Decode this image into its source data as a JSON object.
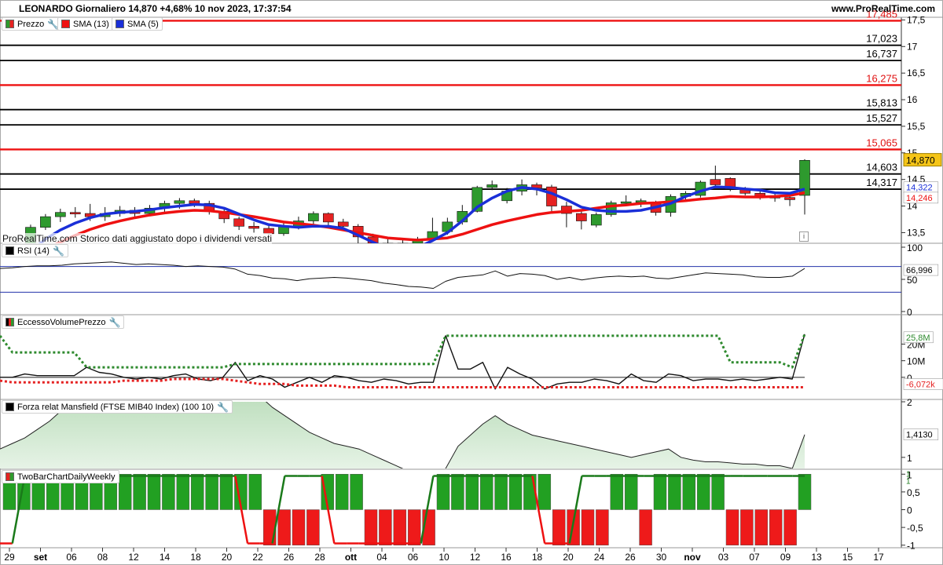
{
  "header": {
    "title": "LEONARDO Giornaliero 14,870 +4,68% 10 nov 2023, 17:37:54",
    "site": "www.ProRealTime.com"
  },
  "legends": {
    "price": "Prezzo",
    "sma13": "SMA (13)",
    "sma5": "SMA (5)",
    "rsi": "RSI (14)",
    "evp": "EccessoVolumePrezzo",
    "mansfield": "Forza relat Mansfield (FTSE MIB40 Index) (100 10)",
    "twobar": "TwoBarChartDailyWeekly"
  },
  "note": "ProRealTime.com Storico dati aggiustato dopo i dividendi versati",
  "colors": {
    "up": "#2e9a2e",
    "down": "#e52222",
    "sma13": "#ee1111",
    "sma5": "#1a2fd8",
    "lastPrice": "#f5c518"
  },
  "chart_data": [
    {
      "type": "candlestick",
      "panel": "Prezzo",
      "ylim": [
        13.3,
        17.55
      ],
      "yticks": [
        "13,5",
        "14",
        "14,5",
        "15",
        "15,5",
        "16",
        "16,5",
        "17",
        "17,5"
      ],
      "x_tick_labels": [
        "29",
        "set",
        "06",
        "08",
        "12",
        "14",
        "18",
        "20",
        "22",
        "26",
        "28",
        "ott",
        "04",
        "06",
        "10",
        "12",
        "16",
        "18",
        "20",
        "24",
        "26",
        "30",
        "nov",
        "03",
        "07",
        "09",
        "13",
        "15",
        "17"
      ],
      "levels": [
        {
          "value": 17.485,
          "label": "17,485",
          "color": "#ee1111"
        },
        {
          "value": 17.023,
          "label": "17,023",
          "color": "#000000"
        },
        {
          "value": 16.737,
          "label": "16,737",
          "color": "#000000"
        },
        {
          "value": 16.275,
          "label": "16,275",
          "color": "#ee1111"
        },
        {
          "value": 15.813,
          "label": "15,813",
          "color": "#000000"
        },
        {
          "value": 15.527,
          "label": "15,527",
          "color": "#000000"
        },
        {
          "value": 15.065,
          "label": "15,065",
          "color": "#ee1111"
        },
        {
          "value": 14.603,
          "label": "14,603",
          "color": "#000000"
        },
        {
          "value": 14.317,
          "label": "14,317",
          "color": "#000000"
        }
      ],
      "last_price": {
        "value": 14.87,
        "label": "14,870"
      },
      "sma5_last": {
        "value": 14.322,
        "label": "14,322"
      },
      "sma13_last": {
        "value": 14.246,
        "label": "14,246"
      },
      "candles": [
        [
          13.2,
          13.3,
          13.05,
          13.38
        ],
        [
          13.3,
          13.6,
          13.25,
          13.65
        ],
        [
          13.6,
          13.8,
          13.55,
          13.85
        ],
        [
          13.8,
          13.88,
          13.7,
          13.95
        ],
        [
          13.88,
          13.86,
          13.78,
          13.98
        ],
        [
          13.86,
          13.8,
          13.72,
          14.04
        ],
        [
          13.8,
          13.86,
          13.72,
          13.98
        ],
        [
          13.86,
          13.92,
          13.8,
          14.0
        ],
        [
          13.92,
          13.86,
          13.78,
          13.98
        ],
        [
          13.86,
          13.96,
          13.82,
          14.02
        ],
        [
          13.96,
          14.05,
          13.88,
          14.1
        ],
        [
          14.05,
          14.1,
          13.95,
          14.15
        ],
        [
          14.1,
          14.05,
          13.98,
          14.14
        ],
        [
          14.05,
          13.9,
          13.84,
          14.1
        ],
        [
          13.9,
          13.76,
          13.68,
          13.94
        ],
        [
          13.76,
          13.62,
          13.55,
          13.8
        ],
        [
          13.62,
          13.58,
          13.5,
          13.7
        ],
        [
          13.58,
          13.48,
          13.42,
          13.64
        ],
        [
          13.48,
          13.62,
          13.44,
          13.68
        ],
        [
          13.62,
          13.72,
          13.56,
          13.8
        ],
        [
          13.72,
          13.86,
          13.66,
          13.9
        ],
        [
          13.86,
          13.7,
          13.64,
          13.88
        ],
        [
          13.7,
          13.62,
          13.56,
          13.76
        ],
        [
          13.62,
          13.42,
          13.3,
          13.66
        ],
        [
          13.42,
          13.3,
          13.2,
          13.48
        ],
        [
          13.3,
          13.25,
          13.1,
          13.4
        ],
        [
          13.25,
          13.3,
          13.15,
          13.38
        ],
        [
          13.3,
          13.38,
          13.18,
          13.42
        ],
        [
          13.38,
          13.52,
          13.34,
          13.78
        ],
        [
          13.52,
          13.7,
          13.46,
          13.78
        ],
        [
          13.7,
          13.9,
          13.65,
          14.02
        ],
        [
          13.9,
          14.35,
          13.88,
          14.38
        ],
        [
          14.35,
          14.4,
          14.3,
          14.48
        ],
        [
          14.1,
          14.28,
          14.05,
          14.34
        ],
        [
          14.28,
          14.4,
          14.2,
          14.5
        ],
        [
          14.4,
          14.34,
          14.2,
          14.44
        ],
        [
          14.36,
          14.0,
          13.9,
          14.4
        ],
        [
          14.0,
          13.86,
          13.6,
          14.08
        ],
        [
          13.86,
          13.72,
          13.56,
          13.9
        ],
        [
          13.64,
          13.84,
          13.6,
          13.88
        ],
        [
          13.84,
          14.06,
          13.8,
          14.1
        ],
        [
          14.06,
          14.08,
          14.0,
          14.2
        ],
        [
          14.08,
          14.1,
          13.98,
          14.14
        ],
        [
          14.06,
          13.88,
          13.82,
          14.1
        ],
        [
          13.88,
          14.18,
          13.8,
          14.22
        ],
        [
          14.18,
          14.24,
          14.1,
          14.28
        ],
        [
          14.2,
          14.45,
          14.16,
          14.48
        ],
        [
          14.5,
          14.4,
          14.35,
          14.76
        ],
        [
          14.52,
          14.32,
          14.28,
          14.54
        ],
        [
          14.32,
          14.24,
          14.2,
          14.36
        ],
        [
          14.24,
          14.18,
          14.12,
          14.3
        ],
        [
          14.18,
          14.16,
          14.08,
          14.24
        ],
        [
          14.16,
          14.12,
          14.0,
          14.2
        ],
        [
          14.2,
          14.86,
          13.84,
          14.88
        ]
      ],
      "sma13": [
        13.05,
        13.1,
        13.2,
        13.32,
        13.45,
        13.56,
        13.65,
        13.72,
        13.78,
        13.83,
        13.87,
        13.9,
        13.92,
        13.91,
        13.88,
        13.84,
        13.8,
        13.75,
        13.7,
        13.67,
        13.64,
        13.6,
        13.55,
        13.5,
        13.45,
        13.4,
        13.38,
        13.36,
        13.38,
        13.4,
        13.47,
        13.56,
        13.65,
        13.72,
        13.78,
        13.84,
        13.88,
        13.9,
        13.92,
        13.96,
        14.0,
        14.02,
        14.05,
        14.06,
        14.08,
        14.1,
        14.13,
        14.15,
        14.18,
        14.17,
        14.17,
        14.18,
        14.2,
        14.25
      ],
      "sma5": [
        13.0,
        13.15,
        13.38,
        13.55,
        13.68,
        13.78,
        13.85,
        13.88,
        13.9,
        13.93,
        13.97,
        14.0,
        14.03,
        14.02,
        13.96,
        13.85,
        13.74,
        13.65,
        13.62,
        13.6,
        13.62,
        13.62,
        13.58,
        13.45,
        13.32,
        13.2,
        13.18,
        13.22,
        13.35,
        13.5,
        13.72,
        13.98,
        14.15,
        14.28,
        14.35,
        14.32,
        14.24,
        14.12,
        13.98,
        13.92,
        13.9,
        13.9,
        13.92,
        13.98,
        14.05,
        14.18,
        14.28,
        14.36,
        14.35,
        14.32,
        14.3,
        14.25,
        14.24,
        14.32
      ]
    },
    {
      "type": "line",
      "panel": "RSI (14)",
      "ylim": [
        0,
        100
      ],
      "yticks": [
        "0",
        "50",
        "100"
      ],
      "levels": [
        30,
        70
      ],
      "last": {
        "value": 66.996,
        "label": "66,996"
      },
      "values": [
        67,
        68,
        70,
        71,
        71,
        72,
        74,
        75,
        76,
        77,
        75,
        73,
        74,
        73,
        72,
        70,
        71,
        70,
        69,
        66,
        58,
        56,
        52,
        51,
        48,
        51,
        52,
        53,
        52,
        50,
        48,
        44,
        42,
        39,
        38,
        36,
        47,
        53,
        55,
        57,
        63,
        55,
        59,
        58,
        56,
        50,
        53,
        49,
        52,
        54,
        55,
        54,
        55,
        52,
        51,
        54,
        57,
        60,
        59,
        58,
        57,
        54,
        53,
        53,
        55,
        67
      ]
    },
    {
      "type": "line",
      "panel": "EccessoVolumePrezzo",
      "ylim": [
        -10000000,
        33000000
      ],
      "ytick_labels": [
        "0",
        "10M",
        "20M",
        "25,8M",
        "-6,072k"
      ],
      "series": [
        {
          "values": [
            0,
            0,
            2,
            1,
            1,
            1,
            1,
            6,
            3,
            2,
            0,
            -1,
            0,
            -1,
            1,
            2,
            -1,
            -2,
            0,
            9,
            -2,
            1,
            -1,
            -6,
            -3,
            0,
            -3,
            1,
            0,
            -2,
            -3,
            -1,
            -2,
            -4,
            -3,
            -3,
            25,
            5,
            5,
            9,
            -7,
            6,
            2,
            -1,
            -7,
            -4,
            -3,
            -3,
            -1,
            -2,
            -4,
            2,
            -2,
            -3,
            2,
            1,
            -2,
            -1,
            -1,
            -2,
            -1,
            -2,
            -1,
            0,
            -1,
            26
          ]
        },
        {
          "values": [
            25,
            15,
            15,
            15,
            15,
            15,
            15,
            6,
            6,
            6,
            6,
            6,
            6,
            6,
            6,
            6,
            6,
            6,
            6,
            8,
            8,
            8,
            8,
            8,
            8,
            8,
            8,
            8,
            8,
            8,
            8,
            8,
            8,
            8,
            8,
            8,
            25,
            25,
            25,
            25,
            25,
            25,
            25,
            25,
            25,
            25,
            25,
            25,
            25,
            25,
            25,
            25,
            25,
            25,
            25,
            25,
            25,
            25,
            25,
            9,
            9,
            9,
            9,
            9,
            6,
            26
          ]
        },
        {
          "values": [
            -2,
            -3,
            -3,
            -3,
            -3,
            -3,
            -3,
            -3,
            -3,
            -3,
            -2,
            -2,
            -2,
            -2,
            -1,
            -1,
            -1,
            -1,
            -1,
            -2,
            -3,
            -4,
            -4,
            -4,
            -5,
            -5,
            -5,
            -5,
            -6,
            -6,
            -6,
            -6,
            -6,
            -6,
            -6,
            -6,
            -6,
            -6,
            -6,
            -6,
            -6,
            -6,
            -6,
            -6,
            -6,
            -6,
            -6,
            -6,
            -6,
            -6,
            -6,
            -6,
            -6,
            -6,
            -6,
            -6,
            -6,
            -6,
            -6,
            -6,
            -6,
            -6,
            -6,
            -6,
            -6,
            -6
          ]
        }
      ]
    },
    {
      "type": "area",
      "panel": "Forza relat Mansfield (FTSE MIB40 Index) (100 10)",
      "ylim": [
        0.8,
        2.0
      ],
      "yticks": [
        "1",
        "2"
      ],
      "last": {
        "value": 1.413,
        "label": "1,4130"
      },
      "values": [
        1.15,
        1.25,
        1.35,
        1.5,
        1.65,
        1.85,
        2.1,
        2.4,
        2.6,
        2.75,
        2.85,
        2.95,
        3.05,
        3.05,
        3.0,
        2.95,
        2.9,
        2.85,
        2.7,
        2.5,
        2.3,
        2.1,
        1.9,
        1.75,
        1.6,
        1.45,
        1.35,
        1.25,
        1.2,
        1.15,
        1.05,
        0.95,
        0.85,
        0.75,
        0.65,
        0.55,
        0.8,
        1.2,
        1.4,
        1.6,
        1.75,
        1.6,
        1.5,
        1.4,
        1.35,
        1.3,
        1.25,
        1.2,
        1.15,
        1.1,
        1.05,
        1.0,
        1.05,
        1.1,
        1.15,
        1.0,
        0.95,
        0.92,
        0.92,
        0.9,
        0.88,
        0.88,
        0.85,
        0.85,
        0.8,
        1.41
      ]
    },
    {
      "type": "bar",
      "panel": "TwoBarChartDailyWeekly",
      "ylim": [
        -1.05,
        1.05
      ],
      "yticks": [
        "-1",
        "-0,5",
        "0",
        "0,5",
        "1"
      ],
      "last_labels": [
        "1",
        "1"
      ],
      "daily": [
        1,
        1,
        1,
        1,
        1,
        1,
        1,
        1,
        1,
        1,
        1,
        1,
        1,
        1,
        1,
        1,
        1,
        1,
        -1,
        -1,
        -1,
        -1,
        1,
        1,
        1,
        -1,
        -1,
        -1,
        -1,
        -1,
        1,
        1,
        1,
        1,
        1,
        1,
        1,
        1,
        -1,
        -1,
        -1,
        -1,
        1,
        1,
        -1,
        1,
        1,
        1,
        1,
        1,
        -1,
        -1,
        -1,
        -1,
        -1,
        1
      ],
      "weekly": [
        -1,
        -1,
        1,
        1,
        1,
        1,
        1,
        1,
        1,
        1,
        1,
        1,
        1,
        1,
        1,
        1,
        1,
        1,
        1,
        1,
        -1,
        -1,
        -1,
        1,
        1,
        1,
        1,
        -1,
        -1,
        -1,
        -1,
        -1,
        -1,
        -1,
        -1,
        1,
        1,
        1,
        1,
        1,
        1,
        1,
        1,
        1,
        -1,
        -1,
        -1,
        1,
        1,
        1,
        1,
        1,
        1,
        1,
        1,
        1,
        1,
        1,
        1,
        1,
        1,
        1,
        1,
        1,
        1,
        1
      ]
    }
  ]
}
